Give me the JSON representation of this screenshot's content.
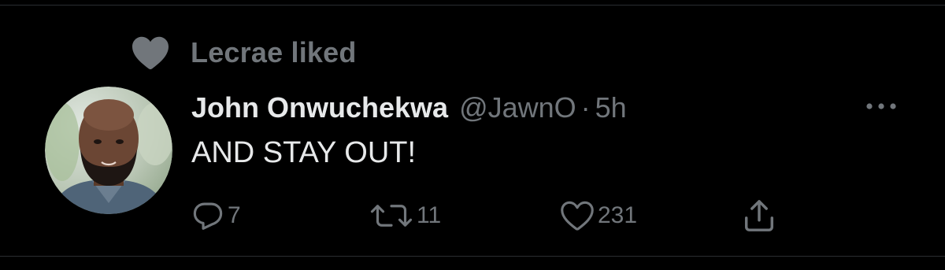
{
  "social_context": {
    "text": "Lecrae liked",
    "icon": "heart-filled-icon"
  },
  "tweet": {
    "author": {
      "display_name": "John Onwuchekwa",
      "handle": "@JawnO",
      "avatar_alt": "avatar"
    },
    "separator": "·",
    "timestamp": "5h",
    "text": "AND STAY OUT!",
    "more_icon": "more-dots-icon"
  },
  "actions": {
    "reply": {
      "icon": "reply-icon",
      "count": "7"
    },
    "retweet": {
      "icon": "retweet-icon",
      "count": "11"
    },
    "like": {
      "icon": "heart-outline-icon",
      "count": "231"
    },
    "share": {
      "icon": "share-icon"
    }
  },
  "colors": {
    "background": "#000000",
    "primary_text": "#e7e9ea",
    "secondary_text": "#71767b",
    "divider": "#2a2d31"
  }
}
